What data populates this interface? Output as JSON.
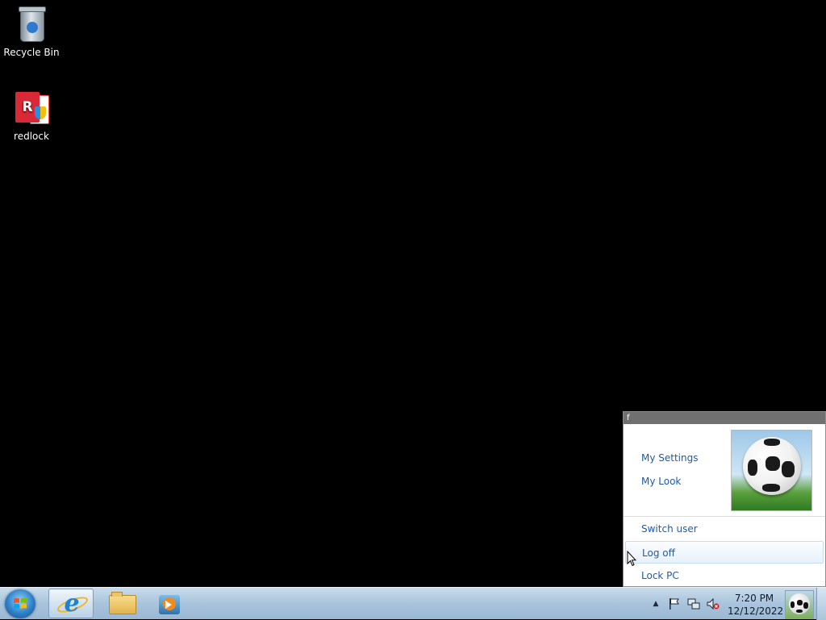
{
  "desktop": {
    "icons": [
      {
        "label": "Recycle Bin",
        "icon": "recycle-bin-icon"
      },
      {
        "label": "redlock",
        "icon": "redlock-icon"
      }
    ]
  },
  "popup": {
    "title": "f",
    "links": {
      "my_settings": "My Settings",
      "my_look": "My Look"
    },
    "items": {
      "switch_user": "Switch user",
      "log_off": "Log off",
      "lock_pc": "Lock PC"
    },
    "avatar": "soccer-ball-icon",
    "link_color": "#1e5aa8"
  },
  "taskbar": {
    "pinned": [
      "start-orb-icon",
      "internet-explorer-icon",
      "windows-explorer-icon",
      "windows-media-player-icon"
    ],
    "tray": {
      "icons": [
        "show-hidden-icons-icon",
        "action-center-flag-icon",
        "network-icon",
        "volume-muted-icon"
      ],
      "time": "7:20 PM",
      "date": "12/12/2022"
    }
  }
}
